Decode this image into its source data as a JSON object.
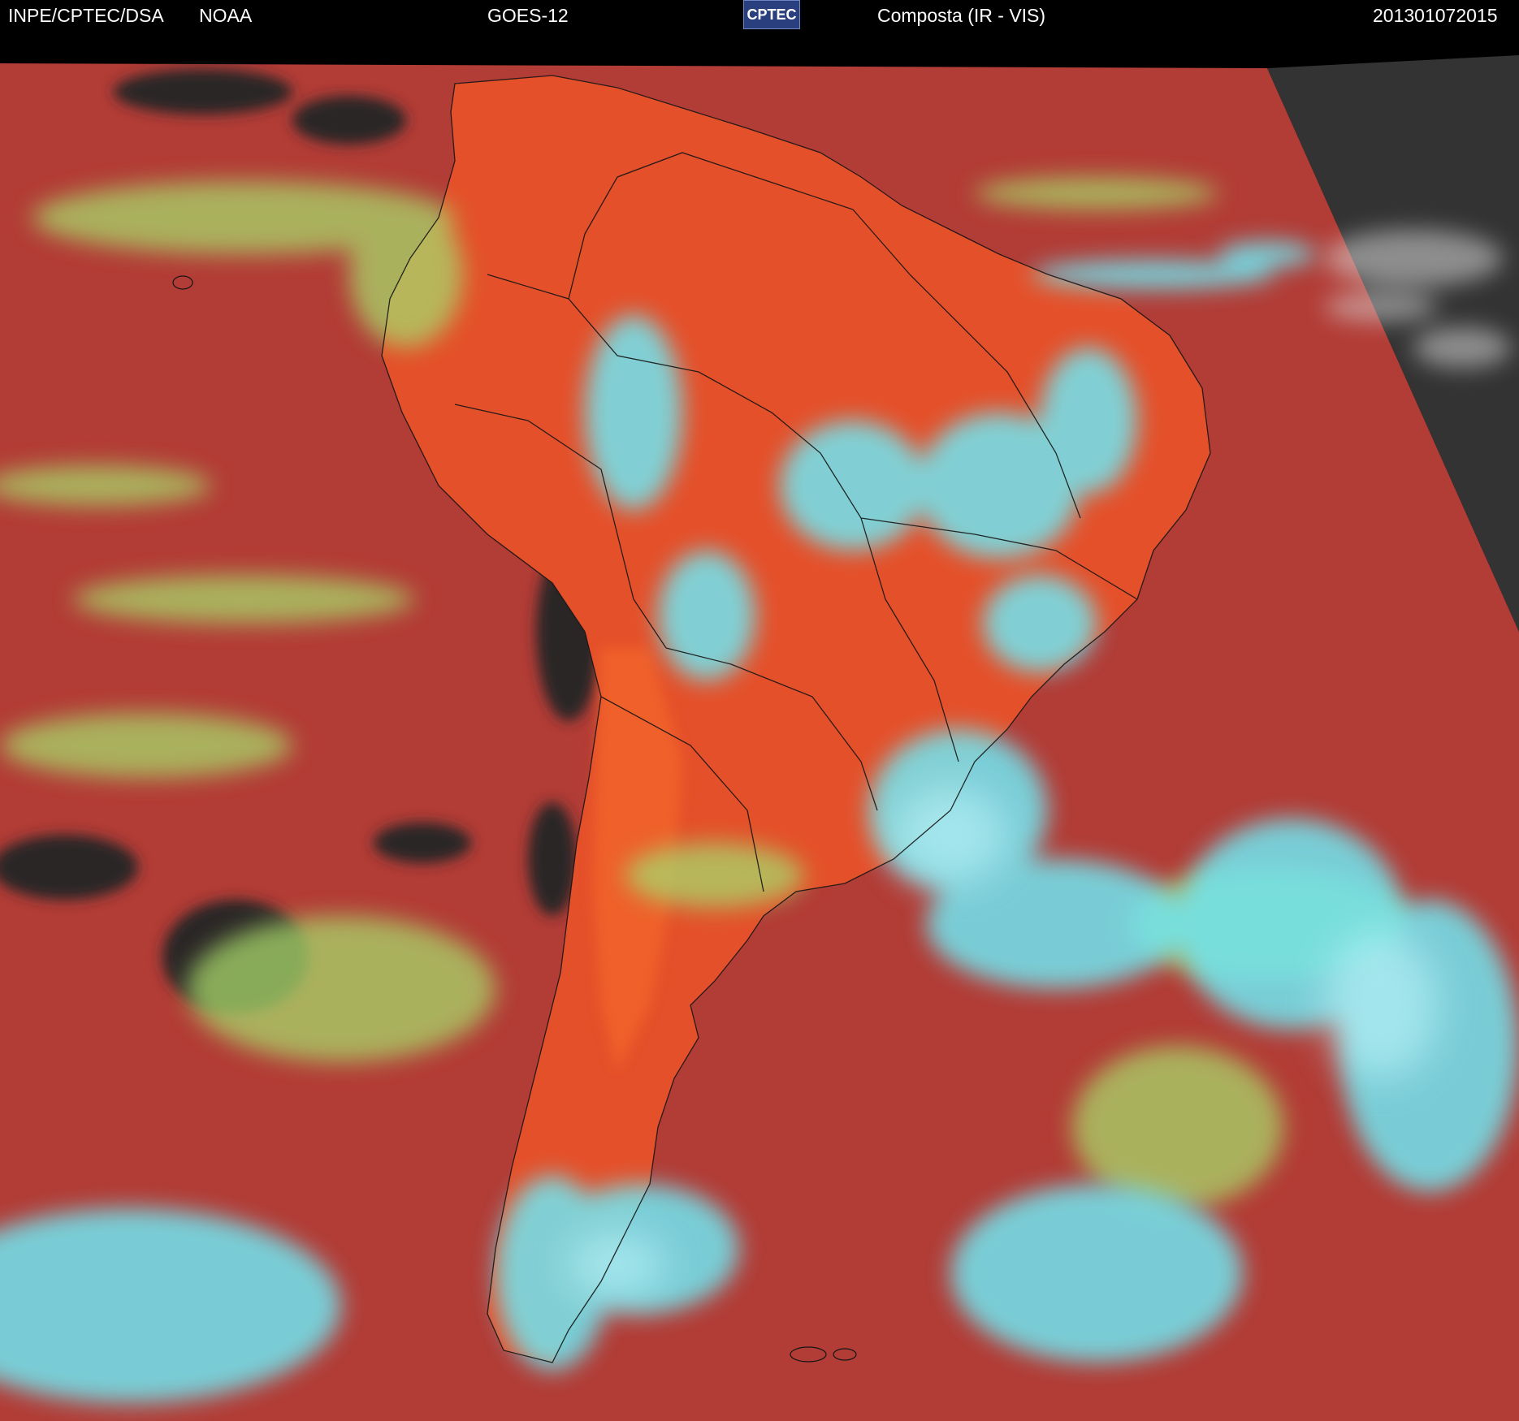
{
  "header": {
    "agency": "INPE/CPTEC/DSA",
    "source": "NOAA",
    "satellite": "GOES-12",
    "logo_text": "CPTEC",
    "product": "Composta (IR - VIS)",
    "timestamp": "201301072015"
  },
  "colors": {
    "ocean_clear": "#b23c36",
    "land_clear": "#e4502a",
    "high_cloud": "#6fe6f2",
    "low_cloud": "#a8d86a",
    "ocean_dark": "#2b2627",
    "night_side": "#333333",
    "border_line": "#151515"
  }
}
